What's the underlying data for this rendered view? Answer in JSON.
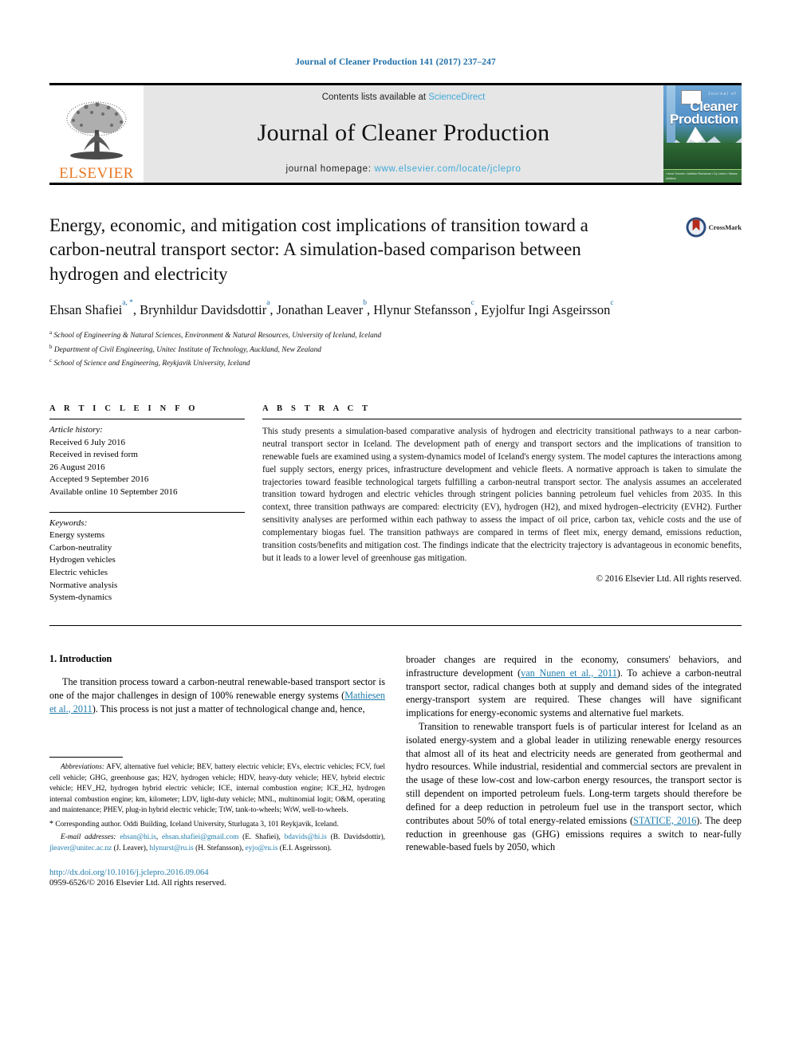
{
  "running_head": "Journal of Cleaner Production 141 (2017) 237–247",
  "masthead": {
    "contents_prefix": "Contents lists available at ",
    "contents_link": "ScienceDirect",
    "journal_title": "Journal of Cleaner Production",
    "homepage_prefix": "journal homepage: ",
    "homepage_url": "www.elsevier.com/locate/jclepro",
    "publisher": "ELSEVIER",
    "cover": {
      "journal_of": "Journal of",
      "line1": "Cleaner",
      "line2": "Production",
      "footer": "▪ Anne Townes   ▪ Addition Ronsenne\n▪ Dy Letom   ▪ Manes Addition"
    }
  },
  "crossmark": {
    "label": "CrossMark"
  },
  "article": {
    "title": "Energy, economic, and mitigation cost implications of transition toward a carbon-neutral transport sector: A simulation-based comparison between hydrogen and electricity",
    "authors": [
      {
        "name": "Ehsan Shafiei",
        "marks": "a, *"
      },
      {
        "name": "Brynhildur Davidsdottir",
        "marks": "a"
      },
      {
        "name": "Jonathan Leaver",
        "marks": "b"
      },
      {
        "name": "Hlynur Stefansson",
        "marks": "c"
      },
      {
        "name": "Eyjolfur Ingi Asgeirsson",
        "marks": "c"
      }
    ],
    "affiliations": [
      {
        "mark": "a",
        "text": "School of Engineering & Natural Sciences, Environment & Natural Resources, University of Iceland, Iceland"
      },
      {
        "mark": "b",
        "text": "Department of Civil Engineering, Unitec Institute of Technology, Auckland, New Zealand"
      },
      {
        "mark": "c",
        "text": "School of Science and Engineering, Reykjavik University, Iceland"
      }
    ]
  },
  "article_info": {
    "heading": "A R T I C L E   I N F O",
    "history_label": "Article history:",
    "history": [
      "Received 6 July 2016",
      "Received in revised form",
      "26 August 2016",
      "Accepted 9 September 2016",
      "Available online 10 September 2016"
    ],
    "keywords_label": "Keywords:",
    "keywords": [
      "Energy systems",
      "Carbon-neutrality",
      "Hydrogen vehicles",
      "Electric vehicles",
      "Normative analysis",
      "System-dynamics"
    ]
  },
  "abstract": {
    "heading": "A B S T R A C T",
    "text": "This study presents a simulation-based comparative analysis of hydrogen and electricity transitional pathways to a near carbon-neutral transport sector in Iceland. The development path of energy and transport sectors and the implications of transition to renewable fuels are examined using a system-dynamics model of Iceland's energy system. The model captures the interactions among fuel supply sectors, energy prices, infrastructure development and vehicle fleets. A normative approach is taken to simulate the trajectories toward feasible technological targets fulfilling a carbon-neutral transport sector. The analysis assumes an accelerated transition toward hydrogen and electric vehicles through stringent policies banning petroleum fuel vehicles from 2035. In this context, three transition pathways are compared: electricity (EV), hydrogen (H2), and mixed hydrogen–electricity (EVH2). Further sensitivity analyses are performed within each pathway to assess the impact of oil price, carbon tax, vehicle costs and the use of complementary biogas fuel. The transition pathways are compared in terms of fleet mix, energy demand, emissions reduction, transition costs/benefits and mitigation cost. The findings indicate that the electricity trajectory is advantageous in economic benefits, but it leads to a lower level of greenhouse gas mitigation.",
    "copyright": "© 2016 Elsevier Ltd. All rights reserved."
  },
  "intro": {
    "heading": "1. Introduction",
    "p1_a": "The transition process toward a carbon-neutral renewable-based transport sector is one of the major challenges in design of 100% renewable energy systems (",
    "p1_cite": "Mathiesen et al., 2011",
    "p1_b": "). This process is not just a matter of technological change and, hence,",
    "p2_a": "broader changes are required in the economy, consumers' behaviors, and infrastructure development (",
    "p2_cite": "van Nunen et al., 2011",
    "p2_b": "). To achieve a carbon-neutral transport sector, radical changes both at supply and demand sides of the integrated energy-transport system are required. These changes will have significant implications for energy-economic systems and alternative fuel markets.",
    "p3_a": "Transition to renewable transport fuels is of particular interest for Iceland as an isolated energy-system and a global leader in utilizing renewable energy resources that almost all of its heat and electricity needs are generated from geothermal and hydro resources. While industrial, residential and commercial sectors are prevalent in the usage of these low-cost and low-carbon energy resources, the transport sector is still dependent on imported petroleum fuels. Long-term targets should therefore be defined for a deep reduction in petroleum fuel use in the transport sector, which contributes about 50% of total energy-related emissions (",
    "p3_cite": "STATICE, 2016",
    "p3_b": "). The deep reduction in greenhouse gas (GHG) emissions requires a switch to near-fully renewable-based fuels by 2050, which"
  },
  "footnotes": {
    "abbrev_label": "Abbreviations:",
    "abbrev_text": " AFV, alternative fuel vehicle; BEV, battery electric vehicle; EVs, electric vehicles; FCV, fuel cell vehicle; GHG, greenhouse gas; H2V, hydrogen vehicle; HDV, heavy-duty vehicle; HEV, hybrid electric vehicle; HEV_H2, hydrogen hybrid electric vehicle; ICE, internal combustion engine; ICE_H2, hydrogen internal combustion engine; km, kilometer; LDV, light-duty vehicle; MNL, multinomial logit; O&M, operating and maintenance; PHEV, plug-in hybrid electric vehicle; TtW, tank-to-wheels; WtW, well-to-wheels.",
    "corresponding": "Corresponding author. Oddi Building, Iceland University, Sturlugata 3, 101 Reykjavik, Iceland.",
    "email_label": "E-mail addresses:",
    "emails": [
      {
        "addr": "ehsan@hi.is",
        "sep": ", "
      },
      {
        "addr": "ehsan.shafiei@gmail.com",
        "sep": " (E. Shafiei), "
      },
      {
        "addr": "bdavids@hi.is",
        "sep": " (B. Davidsdottir), "
      },
      {
        "addr": "jleaver@unitec.ac.nz",
        "sep": " (J. Leaver), "
      },
      {
        "addr": "hlynurst@ru.is",
        "sep": " (H. Stefansson), "
      },
      {
        "addr": "eyjo@ru.is",
        "sep": " (E.I. Asgeirsson)."
      }
    ]
  },
  "doi_block": {
    "doi": "http://dx.doi.org/10.1016/j.jclepro.2016.09.064",
    "issn": "0959-6526/© 2016 Elsevier Ltd. All rights reserved."
  },
  "colors": {
    "link": "#1f7cab",
    "elsevier_orange": "#E87722",
    "masthead_gray": "#e6e6e6",
    "sciencedirect_blue": "#3fa9d8"
  }
}
